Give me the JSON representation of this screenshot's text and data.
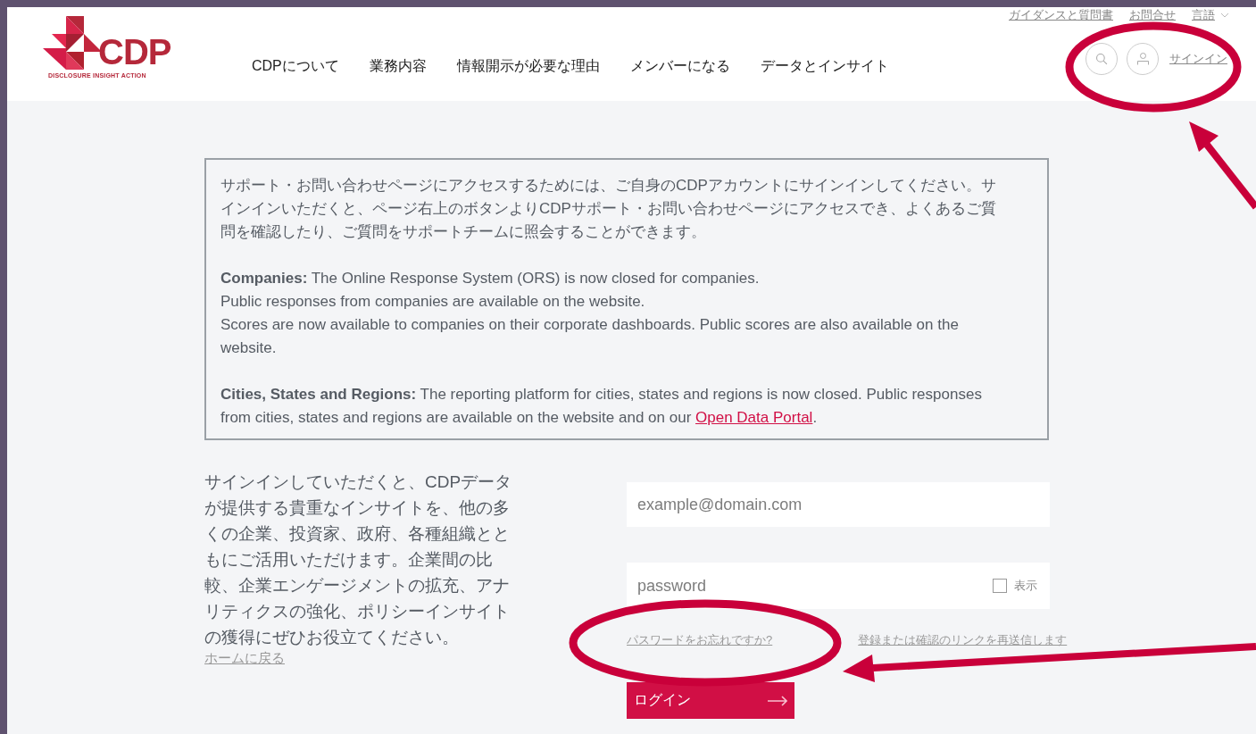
{
  "header": {
    "logo": {
      "wordmark": "CDP",
      "tagline": "DISCLOSURE INSIGHT ACTION"
    },
    "utility_links": [
      {
        "label": "ガイダンスと質問書",
        "kind": "link"
      },
      {
        "label": "お問合せ",
        "kind": "link"
      },
      {
        "label": "言語",
        "kind": "dropdown"
      }
    ],
    "nav": [
      "CDPについて",
      "業務内容",
      "情報開示が必要な理由",
      "メンバーになる",
      "データとインサイト"
    ],
    "sign_in": "サインイン"
  },
  "notice": {
    "intro": "サポート・お問い合わせページにアクセスするためには、ご自身のCDPアカウントにサインインしてください。サインインいただくと、ページ右上のボタンよりCDPサポート・お問い合わせページにアクセスでき、よくあるご質問を確認したり、ご質問をサポートチームに照会することができます。",
    "companies": [
      "**Companies:** The Online Response System (ORS) is now closed for companies.",
      "Public responses from companies are available on the website.",
      "Scores are now available to companies on their corporate dashboards. Public scores are also available on the website."
    ],
    "cities": {
      "text": "**Cities, States and Regions:** The reporting platform for cities, states and regions is now closed. Public responses from cities, states and regions are available on the website and on our ",
      "link": "Open Data Portal",
      "after": "."
    }
  },
  "intro": {
    "text": "サインインしていただくと、CDPデータが提供する貴重なインサイトを、他の多くの企業、投資家、政府、各種組織とともにご活用いただけます。企業間の比較、企業エンゲージメントの拡充、アナリティクスの強化、ポリシーインサイトの獲得にぜひお役立てください。",
    "home_link": "ホームに戻る"
  },
  "form": {
    "email": {
      "placeholder": "example@domain.com"
    },
    "password": {
      "placeholder": "password"
    },
    "show_password": {
      "label": "表示",
      "checked": false
    },
    "forgot_link": "パスワードをお忘れですか?",
    "resend_link": "登録または確認のリンクを再送信します",
    "login_button": "ログイン"
  }
}
